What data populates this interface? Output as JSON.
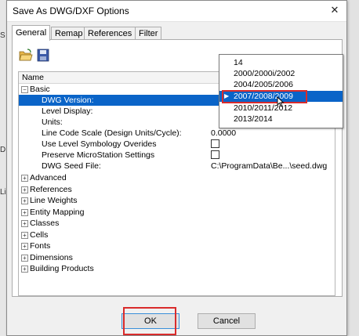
{
  "background": {
    "left_letters": [
      "S",
      "D",
      "Li"
    ]
  },
  "dialog": {
    "title": "Save As DWG/DXF Options",
    "close_glyph": "✕",
    "tabs": [
      "General",
      "Remap",
      "References",
      "Filter"
    ],
    "active_tab": "General",
    "toolbar": [
      "open-folder-icon",
      "save-disk-icon"
    ],
    "grid": {
      "header": "Name",
      "basic": {
        "label": "Basic",
        "rows": [
          {
            "label": "DWG Version:",
            "value": ""
          },
          {
            "label": "Level Display:",
            "value": ""
          },
          {
            "label": "Units:",
            "value": ""
          },
          {
            "label": "Line Code Scale (Design Units/Cycle):",
            "value": "0.0000"
          },
          {
            "label": "Use Level Symbology Overides",
            "value": ""
          },
          {
            "label": "Preserve MicroStation Settings",
            "value": ""
          },
          {
            "label": "DWG Seed File:",
            "value": "C:\\ProgramData\\Be...\\seed.dwg"
          }
        ]
      },
      "groups": [
        "Advanced",
        "References",
        "Line Weights",
        "Entity Mapping",
        "Classes",
        "Cells",
        "Fonts",
        "Dimensions",
        "Building Products"
      ]
    },
    "dwg_version_options": [
      "14",
      "2000/2000i/2002",
      "2004/2005/2006",
      "2007/2008/2009",
      "2010/2011/2012",
      "2013/2014"
    ],
    "selected_version": "2007/2008/2009",
    "buttons": {
      "ok": "OK",
      "cancel": "Cancel"
    },
    "colors": {
      "selection": "#0a64c8",
      "highlight_box": "#d92b2b"
    }
  }
}
